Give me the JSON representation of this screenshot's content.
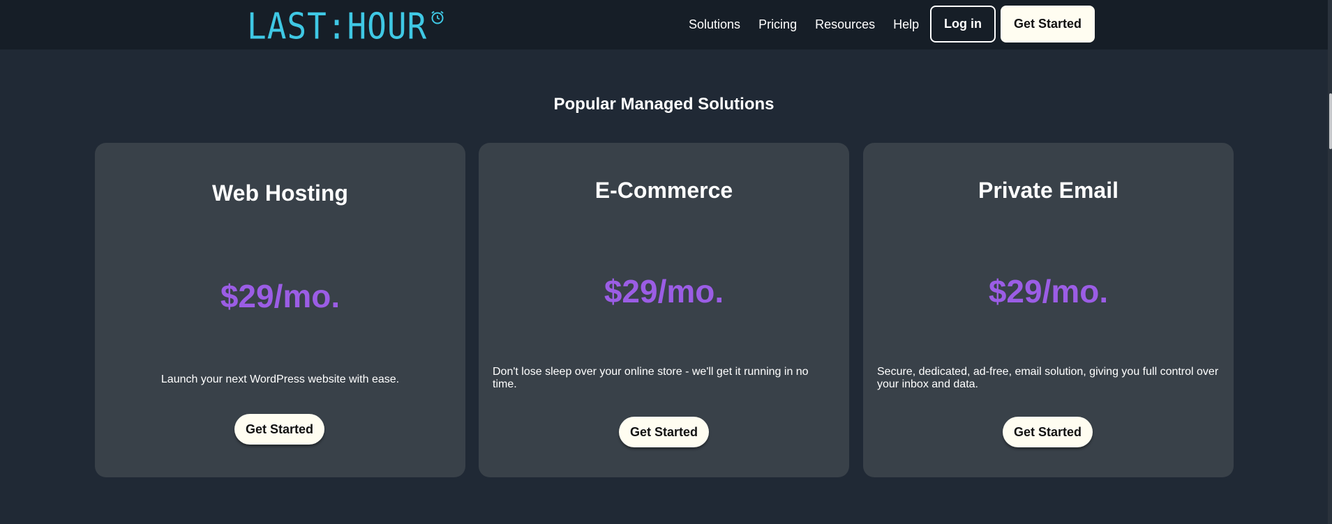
{
  "brand": {
    "logo_text": "LAST:HOUR",
    "logo_color": "#3fc8e4"
  },
  "nav": {
    "links": [
      "Solutions",
      "Pricing",
      "Resources",
      "Help"
    ],
    "login_label": "Log in",
    "get_started_label": "Get Started"
  },
  "section": {
    "title": "Popular Managed Solutions"
  },
  "cards": [
    {
      "title": "Web Hosting",
      "price": "$29/mo.",
      "description": "Launch your next WordPress website with ease.",
      "button_label": "Get Started"
    },
    {
      "title": "E-Commerce",
      "price": "$29/mo.",
      "description": "Don't lose sleep over your online store - we'll get it running in no time.",
      "button_label": "Get Started"
    },
    {
      "title": "Private Email",
      "price": "$29/mo.",
      "description": "Secure, dedicated, ad-free, email solution, giving you full control over your inbox and data.",
      "button_label": "Get Started"
    }
  ],
  "colors": {
    "background": "#202935",
    "navbar": "#161e27",
    "card": "#394149",
    "price": "#9b5de5",
    "button": "#fffdf1"
  },
  "icons": {
    "logo_icon": "alarm-clock-icon"
  }
}
